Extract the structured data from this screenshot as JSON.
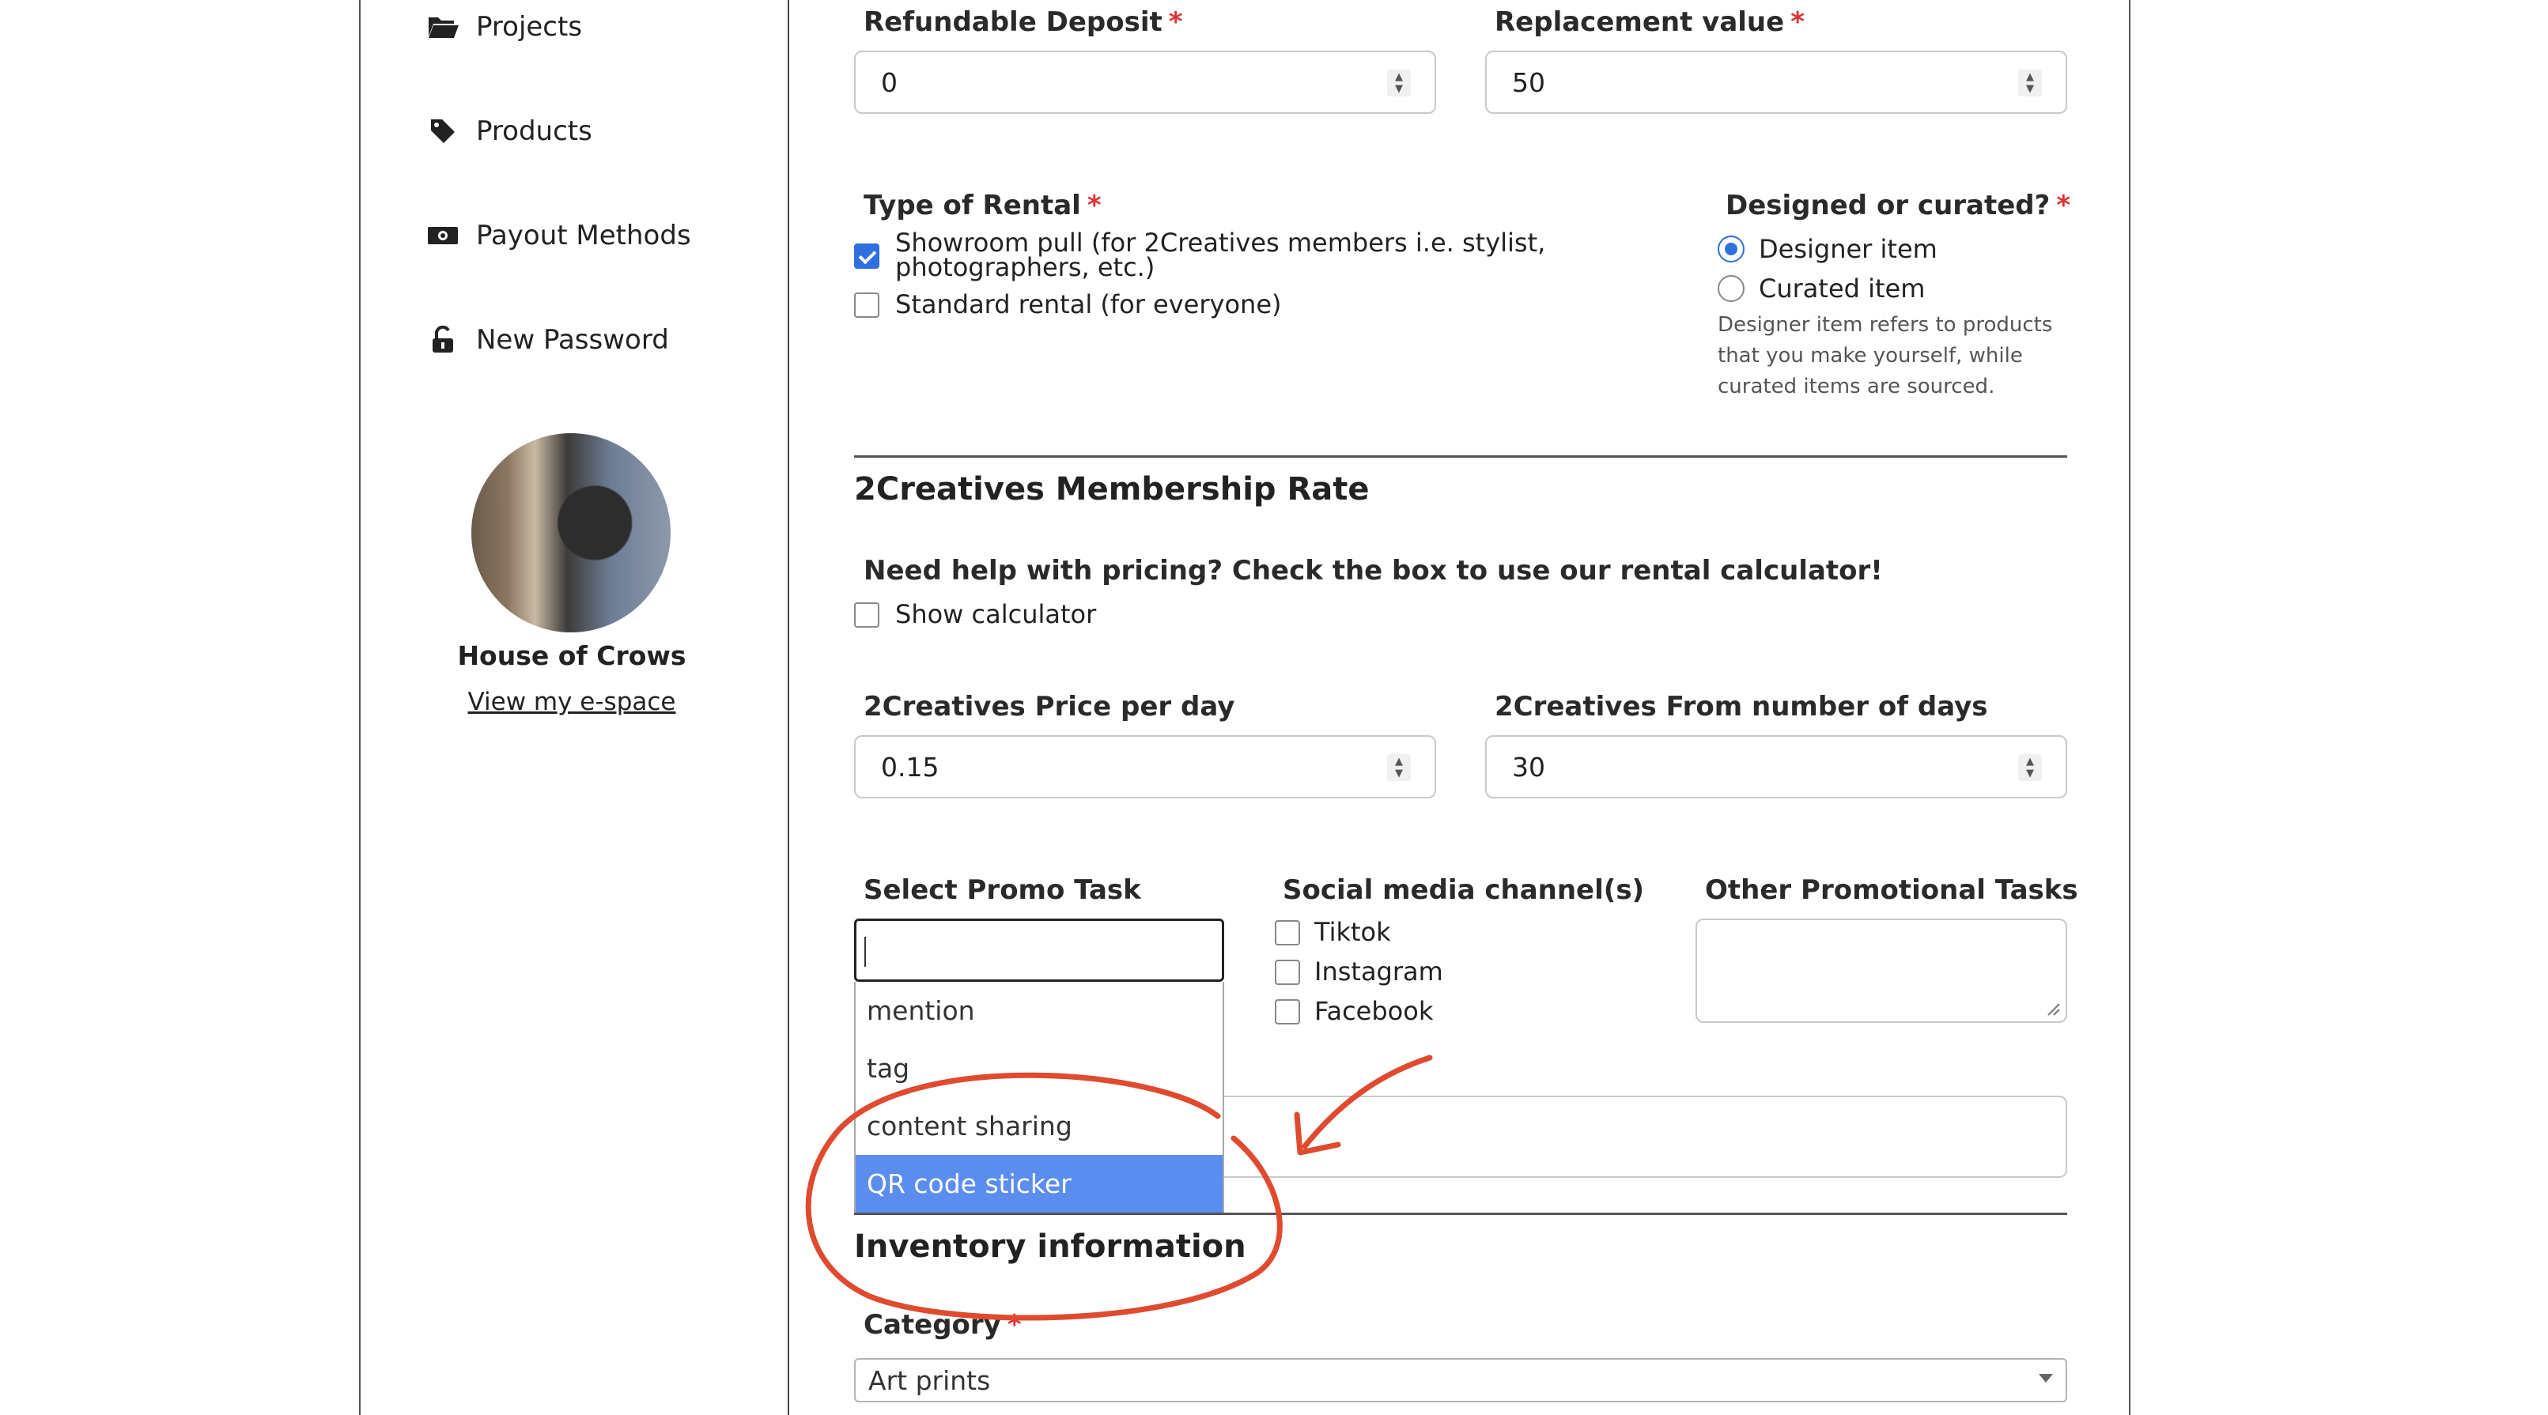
{
  "sidebar": {
    "items": [
      {
        "label": "Projects",
        "icon": "folder-open-icon"
      },
      {
        "label": "Products",
        "icon": "tag-icon"
      },
      {
        "label": "Payout Methods",
        "icon": "money-icon"
      },
      {
        "label": "New Password",
        "icon": "unlock-icon"
      }
    ],
    "profile": {
      "name": "House of Crows",
      "link": "View my e-space"
    }
  },
  "form": {
    "refundable_deposit": {
      "label": "Refundable Deposit",
      "required": "*",
      "value": "0"
    },
    "replacement_value": {
      "label": "Replacement value",
      "required": "*",
      "value": "50"
    },
    "type_of_rental": {
      "label": "Type of Rental",
      "required": "*",
      "options": [
        {
          "label": "Showroom pull (for 2Creatives members i.e. stylist, photographers, etc.)",
          "checked": true
        },
        {
          "label": "Standard rental (for everyone)",
          "checked": false
        }
      ]
    },
    "designed_or_curated": {
      "label": "Designed or curated?",
      "required": "*",
      "options": [
        {
          "label": "Designer item",
          "selected": true
        },
        {
          "label": "Curated item",
          "selected": false
        }
      ],
      "help": "Designer item refers to products that you make yourself, while curated items are sourced."
    },
    "membership_title": "2Creatives Membership Rate",
    "pricing_help": {
      "label": "Need help with pricing? Check the box to use our rental calculator!",
      "checkbox_label": "Show calculator",
      "checked": false
    },
    "price_per_day": {
      "label": "2Creatives Price per day",
      "value": "0.15"
    },
    "from_days": {
      "label": "2Creatives From number of days",
      "value": "30"
    },
    "promo_task": {
      "label": "Select Promo Task",
      "search_value": "",
      "options": [
        "mention",
        "tag",
        "content sharing",
        "QR code sticker"
      ],
      "highlighted": "QR code sticker"
    },
    "social_channels": {
      "label": "Social media channel(s)",
      "options": [
        {
          "label": "Tiktok",
          "checked": false
        },
        {
          "label": "Instagram",
          "checked": false
        },
        {
          "label": "Facebook",
          "checked": false
        }
      ]
    },
    "other_tasks": {
      "label": "Other Promotional Tasks",
      "value": ""
    },
    "inventory_title": "Inventory information",
    "category": {
      "label": "Category",
      "required": "*",
      "value": "Art prints"
    }
  },
  "colors": {
    "accent": "#2f6fe0",
    "highlight": "#5b8def",
    "required": "#dd3333",
    "annotation": "#e04a2f"
  }
}
